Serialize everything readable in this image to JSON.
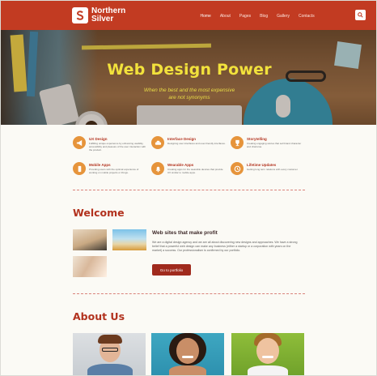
{
  "header": {
    "brand_line1": "Northern",
    "brand_line2": "Silver",
    "nav": [
      "Home",
      "About",
      "Pages",
      "Blog",
      "Gallery",
      "Contacts"
    ],
    "active_nav": "Home",
    "accent_color": "#c23b22"
  },
  "hero": {
    "title": "Web Design Power",
    "subtitle_line1": "When the best and the most expensive",
    "subtitle_line2": "are not synonyms"
  },
  "features": [
    {
      "title": "UX Design",
      "icon": "megaphone-icon",
      "desc": "Fulfilling unique experience by enhancing usability, accessibility and pleasure of the user interaction with the product."
    },
    {
      "title": "Interface Design",
      "icon": "car-icon",
      "desc": "Designing user interfaces and user-friendly interfaces."
    },
    {
      "title": "Storytelling",
      "icon": "trophy-icon",
      "desc": "Creating engaging stories that sell brand character and charisma."
    },
    {
      "title": "Mobile Apps",
      "icon": "mobile-icon",
      "desc": "Providing users with the optimal experience of working on mobile projects or things."
    },
    {
      "title": "Wearable Apps",
      "icon": "bell-icon",
      "desc": "Creating apps for the wearable devices that provide UX similar to mobile apps."
    },
    {
      "title": "Lifetime Updates",
      "icon": "clock-icon",
      "desc": "Getting long term relations with every customer."
    }
  ],
  "welcome": {
    "heading": "Welcome",
    "title": "Web sites that make profit",
    "text": "We are a digital design agency and we are all about discovering new designs and approaches. We have a strong belief that a powerful web design can make any business (either a startup or a corporation with years on the market) a success. Our professionalism is confirmed by our portfolio.",
    "button": "Go to portfolio"
  },
  "about": {
    "heading": "About Us"
  }
}
